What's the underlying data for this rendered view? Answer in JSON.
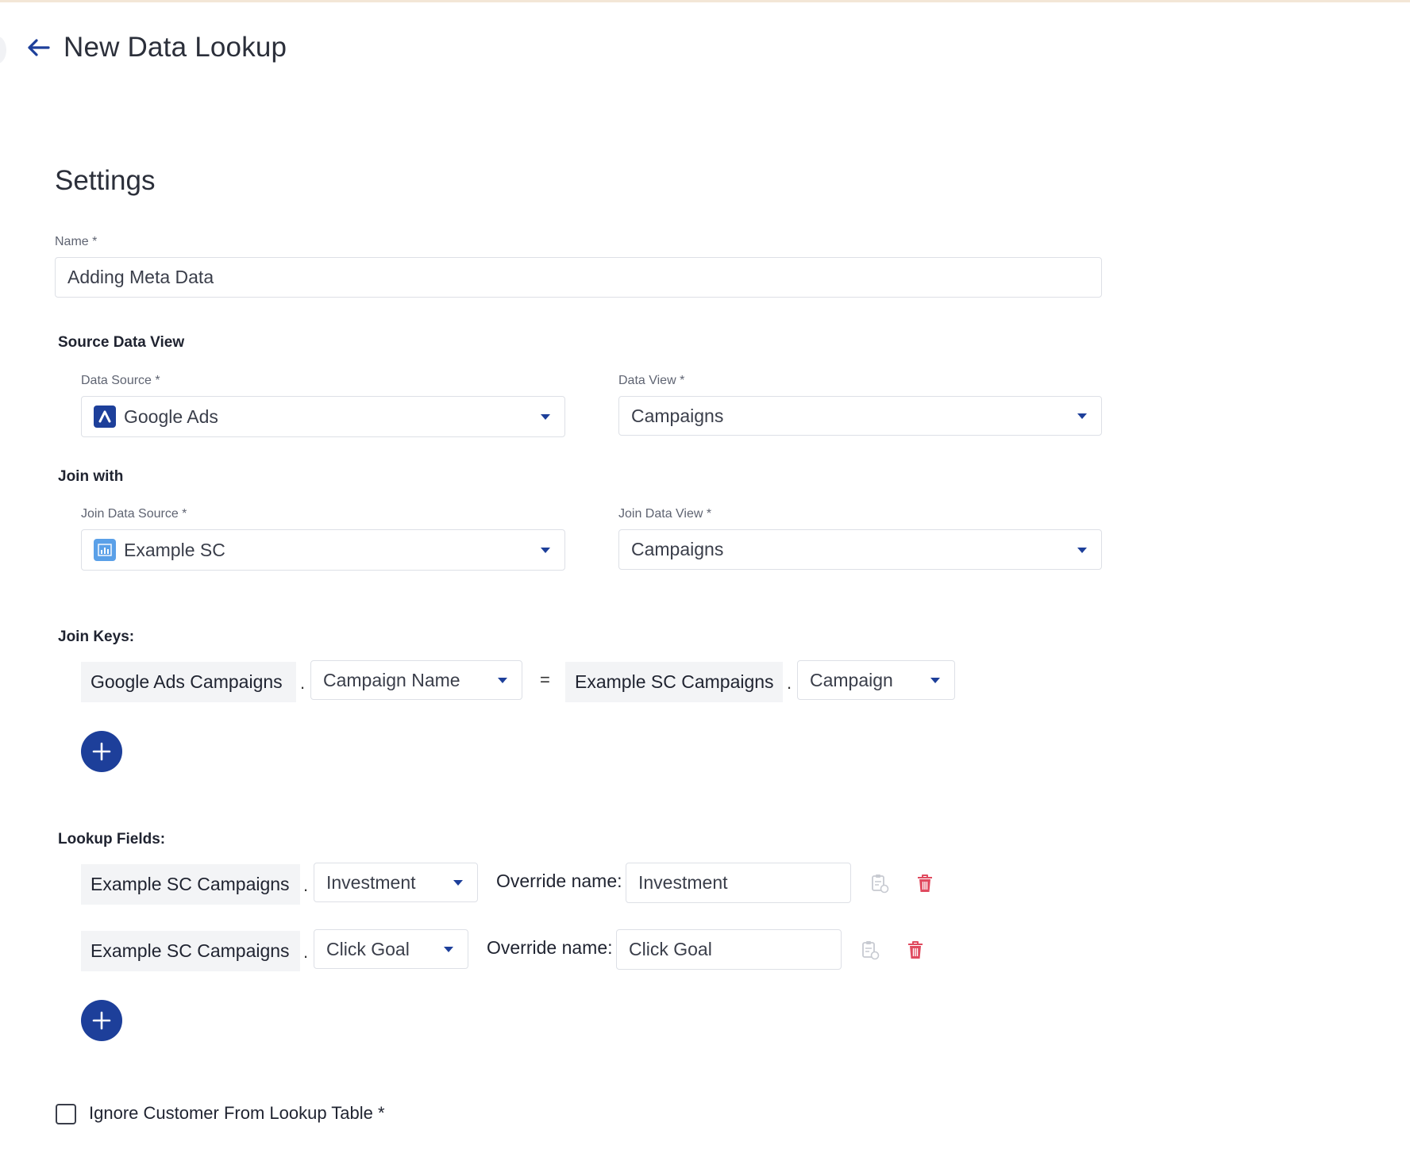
{
  "header": {
    "title": "New Data Lookup",
    "back_icon": "arrow-left-icon"
  },
  "settings": {
    "title": "Settings",
    "name_label": "Name *",
    "name_value": "Adding Meta Data"
  },
  "source": {
    "section_label": "Source Data View",
    "data_source_label": "Data Source *",
    "data_source_value": "Google Ads",
    "data_source_icon": "google-ads-icon",
    "data_view_label": "Data View *",
    "data_view_value": "Campaigns"
  },
  "join": {
    "section_label": "Join with",
    "data_source_label": "Join Data Source *",
    "data_source_value": "Example SC",
    "data_source_icon": "bar-chart-icon",
    "data_view_label": "Join Data View *",
    "data_view_value": "Campaigns"
  },
  "join_keys": {
    "section_label": "Join Keys:",
    "left_table": "Google Ads Campaigns",
    "left_field": "Campaign Name",
    "dot": ".",
    "equals": "=",
    "right_table": "Example SC Campaigns",
    "right_field": "Campaign"
  },
  "lookup_fields": {
    "section_label": "Lookup Fields:",
    "override_label": "Override name:",
    "rows": [
      {
        "table": "Example SC Campaigns",
        "field": "Investment",
        "override": "Investment"
      },
      {
        "table": "Example SC Campaigns",
        "field": "Click Goal",
        "override": "Click Goal"
      }
    ]
  },
  "ignore_customer": {
    "label": "Ignore Customer From Lookup Table *",
    "checked": false
  },
  "colors": {
    "primary": "#1d3f9a",
    "danger": "#e04a5f",
    "muted_icon": "#c7cad1"
  }
}
